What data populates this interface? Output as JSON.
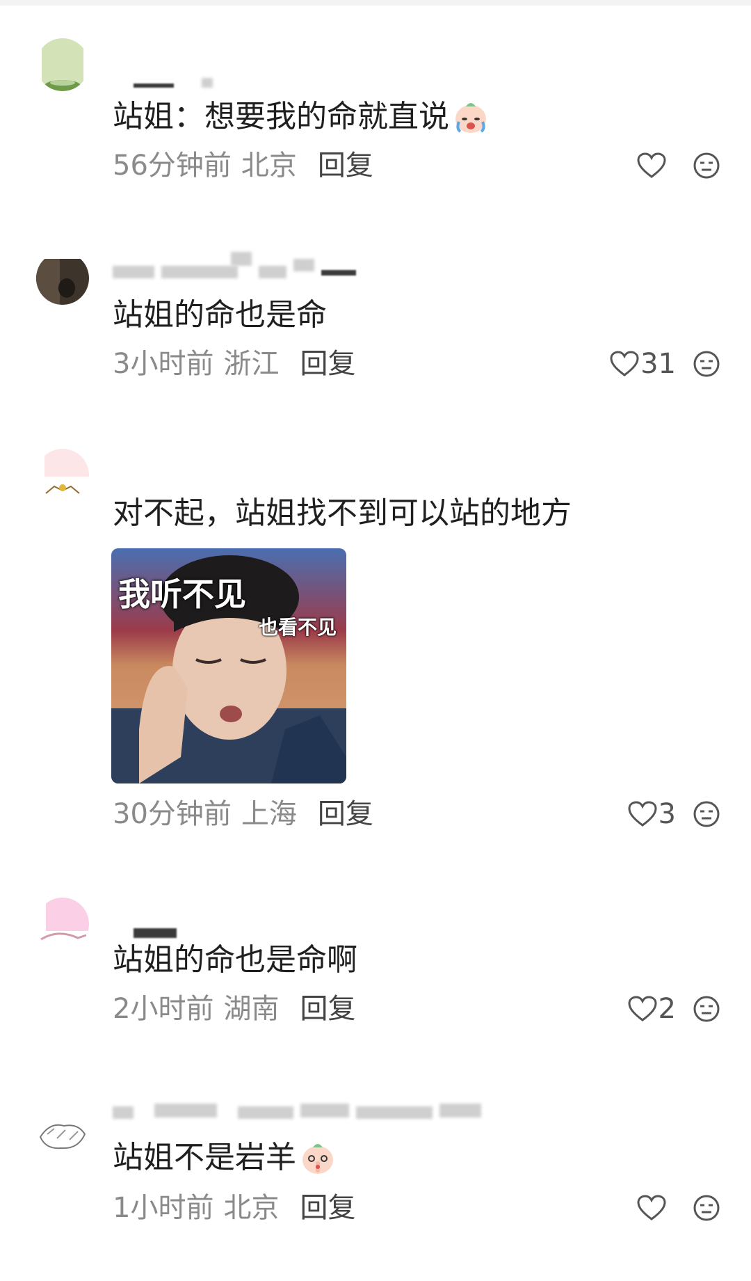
{
  "comments": [
    {
      "text": "站姐：想要我的命就直说",
      "emoji": "crying-face-emoji",
      "time": "56分钟前",
      "location": "北京",
      "reply": "回复",
      "likes": ""
    },
    {
      "text": "站姐的命也是命",
      "time": "3小时前",
      "location": "浙江",
      "reply": "回复",
      "likes": "31"
    },
    {
      "text": "对不起，站姐找不到可以站的地方",
      "time": "30分钟前",
      "location": "上海",
      "reply": "回复",
      "likes": "3",
      "meme": {
        "caption_main": "我听不见",
        "caption_sub": "也看不见"
      }
    },
    {
      "text": "站姐的命也是命啊",
      "time": "2小时前",
      "location": "湖南",
      "reply": "回复",
      "likes": "2"
    },
    {
      "text": "站姐不是岩羊",
      "emoji": "shushing-face-emoji",
      "time": "1小时前",
      "location": "北京",
      "reply": "回复",
      "likes": ""
    }
  ],
  "icons": {
    "like": "heart-outline-icon",
    "dislike": "neutral-face-icon"
  },
  "colors": {
    "text": "#1f1f1f",
    "meta": "#8a8a8a",
    "reply": "#444444"
  }
}
